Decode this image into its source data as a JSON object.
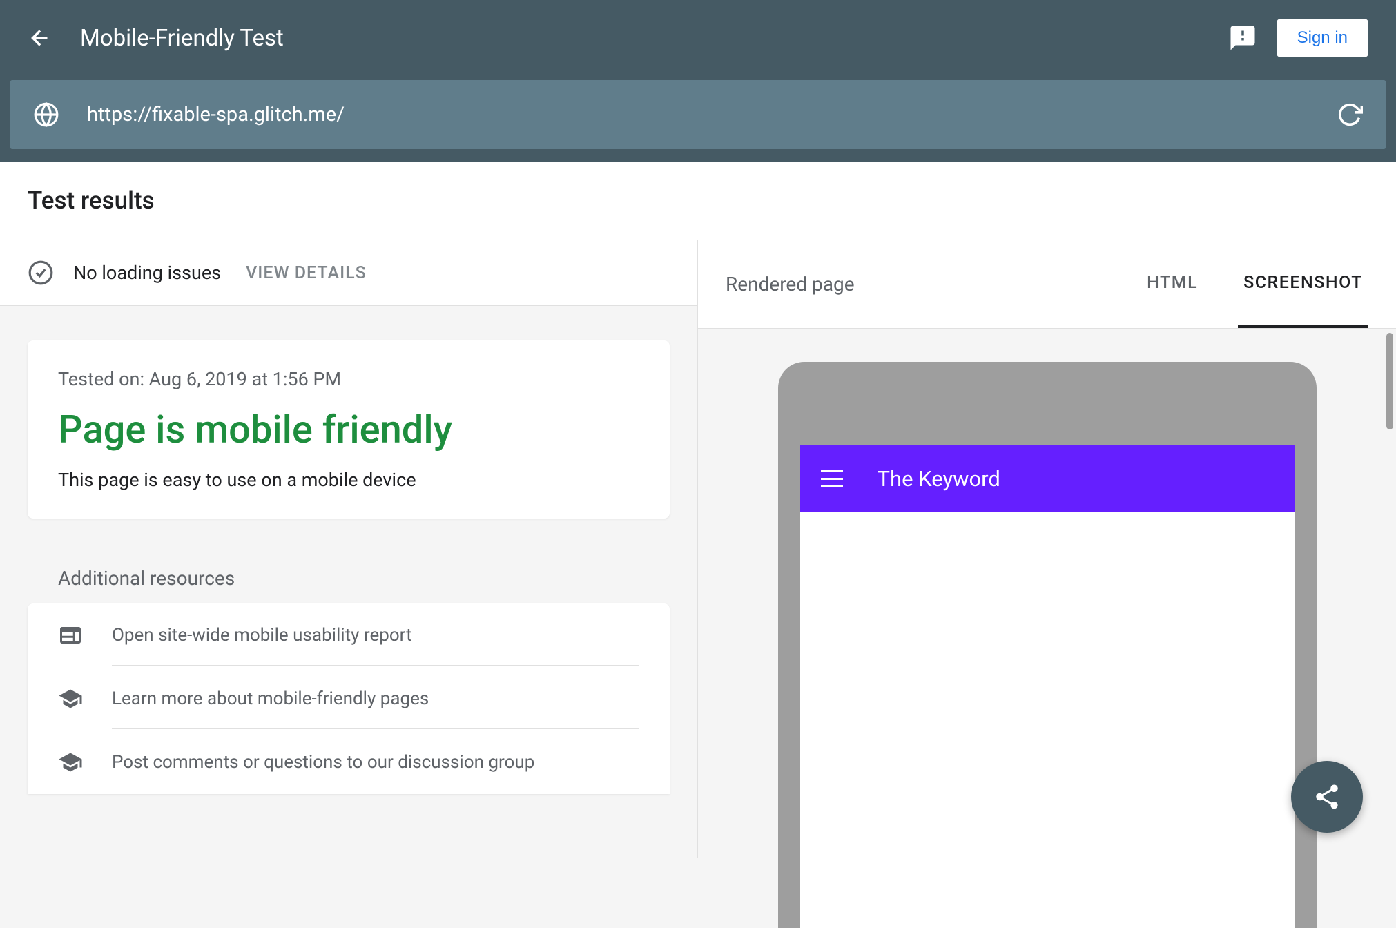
{
  "header": {
    "title": "Mobile-Friendly Test",
    "signin_label": "Sign in"
  },
  "url_bar": {
    "url": "https://fixable-spa.glitch.me/"
  },
  "results": {
    "heading": "Test results",
    "loading_status": "No loading issues",
    "view_details_label": "VIEW DETAILS",
    "tested_on": "Tested on: Aug 6, 2019 at 1:56 PM",
    "headline": "Page is mobile friendly",
    "subtext": "This page is easy to use on a mobile device"
  },
  "resources": {
    "title": "Additional resources",
    "items": [
      {
        "label": "Open site-wide mobile usability report"
      },
      {
        "label": "Learn more about mobile-friendly pages"
      },
      {
        "label": "Post comments or questions to our discussion group"
      }
    ]
  },
  "right": {
    "rendered_label": "Rendered page",
    "tabs": {
      "html": "HTML",
      "screenshot": "SCREENSHOT"
    }
  },
  "mock": {
    "title": "The Keyword"
  }
}
